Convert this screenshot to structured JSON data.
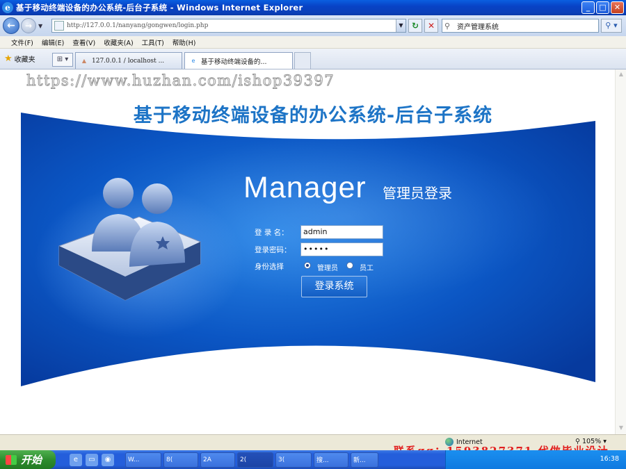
{
  "window": {
    "title": "基于移动终端设备的办公系统-后台子系统 - Windows Internet Explorer",
    "min_label": "_",
    "max_label": "□",
    "close_label": "✕"
  },
  "addressbar": {
    "url": "http://127.0.0.1/nanyang/gongwen/login.php",
    "search_value": "资产管理系统"
  },
  "menu": {
    "items": [
      "文件(F)",
      "编辑(E)",
      "查看(V)",
      "收藏夹(A)",
      "工具(T)",
      "帮助(H)"
    ]
  },
  "tabs": {
    "favorites_label": "收藏夹",
    "items": [
      {
        "label": "127.0.0.1 / localhost ...",
        "icon": "phpmyadmin-icon"
      },
      {
        "label": "基于移动终端设备的...",
        "icon": "ie-page-icon"
      }
    ]
  },
  "page": {
    "watermark": "https://www.huzhan.com/ishop39397",
    "system_title": "基于移动终端设备的办公系统-后台子系统",
    "manager_word": "Manager",
    "manager_sub": "管理员登录",
    "form": {
      "username_label": "登 录 名：",
      "username_value": "admin",
      "password_label": "登录密码：",
      "password_value": "•••••",
      "role_label": "身份选择",
      "role_options": [
        "管理员",
        "员工"
      ],
      "role_selected": "管理员",
      "submit_label": "登录系统"
    }
  },
  "statusbar": {
    "zone": "Internet",
    "zoom": "105%",
    "overlay_contact": "联系qq：1593827371 代做毕业设计"
  },
  "taskbar": {
    "start_label": "开始",
    "tasks": [
      "W...",
      "8(",
      "2A",
      "2(",
      "3(",
      "搜...",
      "新..."
    ],
    "clock": "16:38"
  },
  "colors": {
    "title_blue": "#1d74c6",
    "banner_blue": "#0b56c4",
    "taskbar_blue": "#245edb",
    "start_green": "#2e8d2e",
    "overlay_red": "#e02020"
  }
}
